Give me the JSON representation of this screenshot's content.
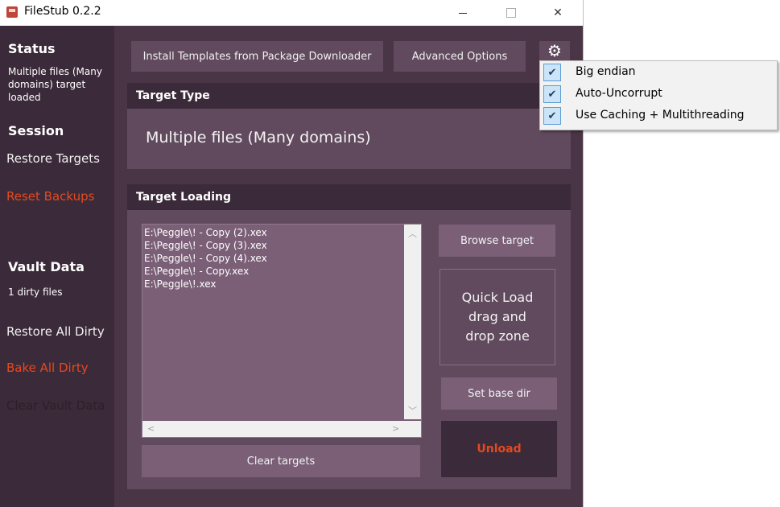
{
  "window": {
    "title": "FileStub 0.2.2",
    "controls": {
      "minimize": "",
      "maximize": "",
      "close": "✕"
    }
  },
  "sidebar": {
    "status_heading": "Status",
    "status_text": "Multiple files (Many domains) target loaded",
    "session_heading": "Session",
    "restore_targets": "Restore Targets",
    "reset_backups": "Reset Backups",
    "vault_heading": "Vault Data",
    "vault_count": "1 dirty files",
    "restore_all_dirty": "Restore All Dirty",
    "bake_all_dirty": "Bake All Dirty",
    "clear_vault_data": "Clear Vault Data"
  },
  "toolbar": {
    "install_templates": "Install Templates from Package Downloader",
    "advanced_options": "Advanced Options",
    "settings_icon": "gear-icon"
  },
  "target_type": {
    "header": "Target Type",
    "value": "Multiple files (Many domains)"
  },
  "target_loading": {
    "header": "Target Loading",
    "files": [
      "E:\\Peggle\\! - Copy (2).xex",
      "E:\\Peggle\\! - Copy (3).xex",
      "E:\\Peggle\\! - Copy (4).xex",
      "E:\\Peggle\\! - Copy.xex",
      "E:\\Peggle\\!.xex"
    ],
    "browse_target": "Browse target",
    "quick_load": "Quick Load drag and drop zone",
    "set_base_dir": "Set base dir",
    "unload": "Unload",
    "clear_targets": "Clear targets"
  },
  "dropdown_menu": {
    "items": [
      {
        "label": "Big endian",
        "checked": true
      },
      {
        "label": "Auto-Uncorrupt",
        "checked": true
      },
      {
        "label": "Use Caching + Multithreading",
        "checked": true
      }
    ]
  },
  "colors": {
    "accent_red": "#e34a1f",
    "sidebar_bg": "#3b2a39",
    "panel_bg": "#614a5e"
  }
}
